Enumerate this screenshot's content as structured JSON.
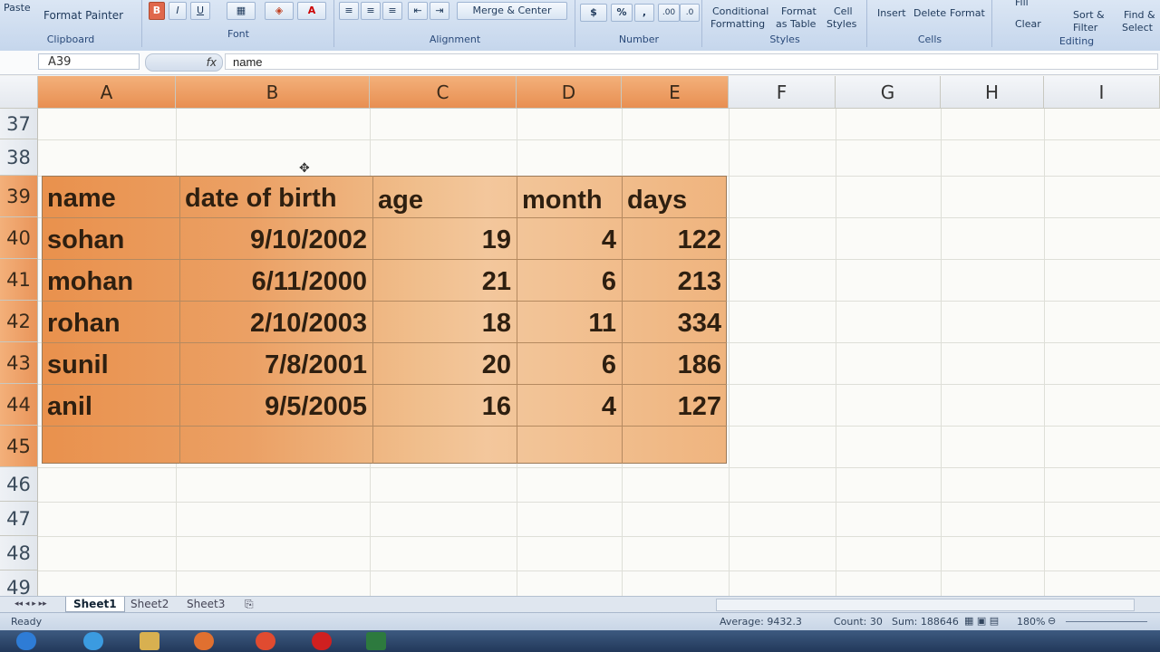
{
  "ribbon": {
    "clipboard": {
      "paste": "Paste",
      "format_painter": "Format Painter",
      "label": "Clipboard"
    },
    "font": {
      "bold": "B",
      "italic": "I",
      "underline": "U",
      "label": "Font"
    },
    "alignment": {
      "merge_center": "Merge & Center",
      "label": "Alignment"
    },
    "number": {
      "currency": "$",
      "percent": "%",
      "comma": ",",
      "label": "Number"
    },
    "styles": {
      "conditional": "Conditional",
      "formatting": "Formatting",
      "format": "Format",
      "as_table": "as Table",
      "cell": "Cell",
      "styles_btn": "Styles",
      "label": "Styles"
    },
    "cells": {
      "insert": "Insert",
      "delete": "Delete",
      "format": "Format",
      "label": "Cells"
    },
    "editing": {
      "fill": "Fill",
      "clear": "Clear",
      "sort": "Sort &",
      "filter": "Filter",
      "find": "Find &",
      "select": "Select",
      "label": "Editing"
    }
  },
  "formula_bar": {
    "name_box": "A39",
    "fx": "fx",
    "value": "name"
  },
  "columns": [
    "A",
    "B",
    "C",
    "D",
    "E",
    "F",
    "G",
    "H",
    "I"
  ],
  "rows": [
    "37",
    "38",
    "39",
    "40",
    "41",
    "42",
    "43",
    "44",
    "45",
    "46",
    "47",
    "48",
    "49"
  ],
  "table": {
    "headers": [
      "name",
      "date of birth",
      "age",
      "month",
      "days"
    ],
    "rows": [
      [
        "sohan",
        "9/10/2002",
        "19",
        "4",
        "122"
      ],
      [
        "mohan",
        "6/11/2000",
        "21",
        "6",
        "213"
      ],
      [
        "rohan",
        "2/10/2003",
        "18",
        "11",
        "334"
      ],
      [
        "sunil",
        "7/8/2001",
        "20",
        "6",
        "186"
      ],
      [
        "anil",
        "9/5/2005",
        "16",
        "4",
        "127"
      ]
    ]
  },
  "sheets": [
    "Sheet1",
    "Sheet2",
    "Sheet3"
  ],
  "status": {
    "ready": "Ready",
    "average": "Average: 9432.3",
    "count": "Count: 30",
    "sum": "Sum: 188646",
    "zoom": "180%"
  }
}
